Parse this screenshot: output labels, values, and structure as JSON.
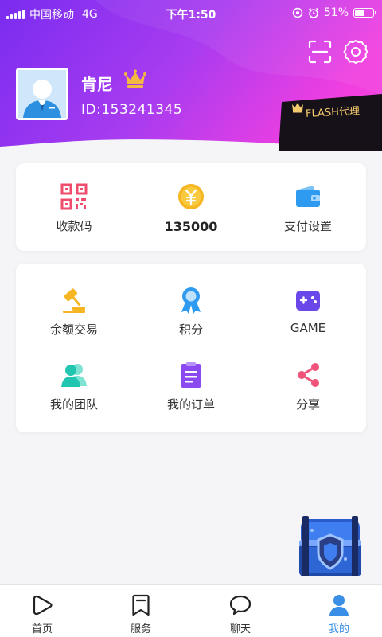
{
  "status_bar": {
    "carrier": "中国移动",
    "network": "4G",
    "time": "下午1:50",
    "battery": "51%"
  },
  "profile": {
    "name": "肯尼",
    "id": "ID:153241345",
    "agent_badge": "FLASH代理"
  },
  "wallet": [
    {
      "label": "收款码",
      "icon": "qr-code-icon"
    },
    {
      "amount": "135000",
      "icon": "yuan-coin-icon"
    },
    {
      "label": "支付设置",
      "icon": "wallet-icon"
    }
  ],
  "services": [
    {
      "label": "余额交易",
      "icon": "gavel-icon"
    },
    {
      "label": "积分",
      "icon": "badge-icon"
    },
    {
      "label": "GAME",
      "icon": "gamepad-icon"
    },
    {
      "label": "我的团队",
      "icon": "team-icon"
    },
    {
      "label": "我的订单",
      "icon": "order-icon"
    },
    {
      "label": "分享",
      "icon": "share-icon"
    }
  ],
  "tabs": [
    {
      "label": "首页",
      "icon": "home-play-icon"
    },
    {
      "label": "服务",
      "icon": "bookmark-icon"
    },
    {
      "label": "聊天",
      "icon": "chat-bubble-icon"
    },
    {
      "label": "我的",
      "icon": "person-icon",
      "active": true
    }
  ],
  "colors": {
    "header_start": "#7a2cf0",
    "header_end": "#f23fe0",
    "accent": "#3a8ee6",
    "gold": "#f3c96b"
  }
}
